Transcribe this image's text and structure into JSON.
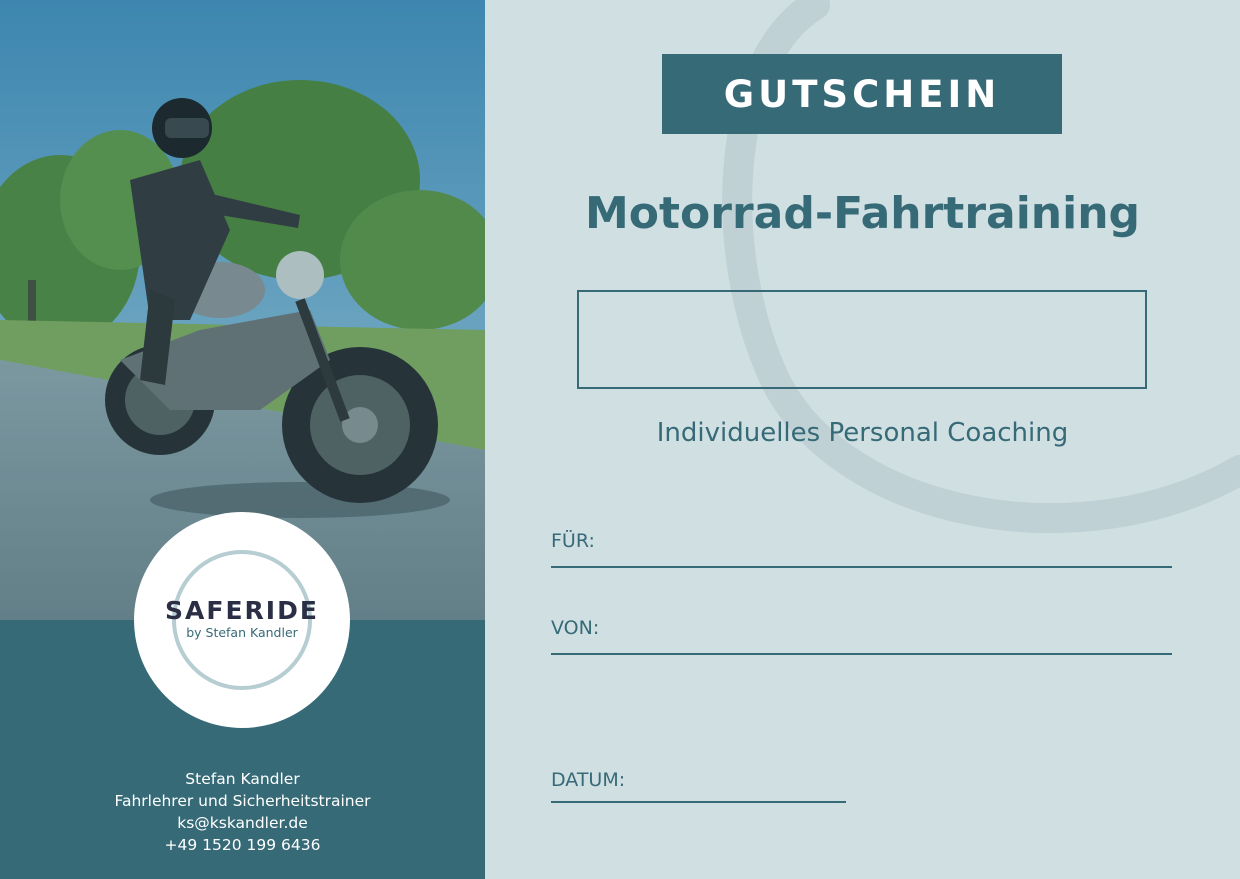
{
  "voucher": {
    "heading": "GUTSCHEIN",
    "title": "Motorrad-Fahrtraining",
    "subtitle": "Individuelles Personal Coaching",
    "fields": {
      "for_label": "FÜR:",
      "from_label": "VON:",
      "date_label": "DATUM:"
    }
  },
  "logo": {
    "wordmark": "SAFERIDE",
    "byline": "by Stefan Kandler"
  },
  "contact": {
    "name": "Stefan Kandler",
    "role": "Fahrlehrer und Sicherheitstrainer",
    "email": "ks@kskandler.de",
    "phone": "+49 1520 199 6436"
  },
  "colors": {
    "teal": "#366a77",
    "background": "#d0dfe2",
    "white": "#ffffff"
  }
}
